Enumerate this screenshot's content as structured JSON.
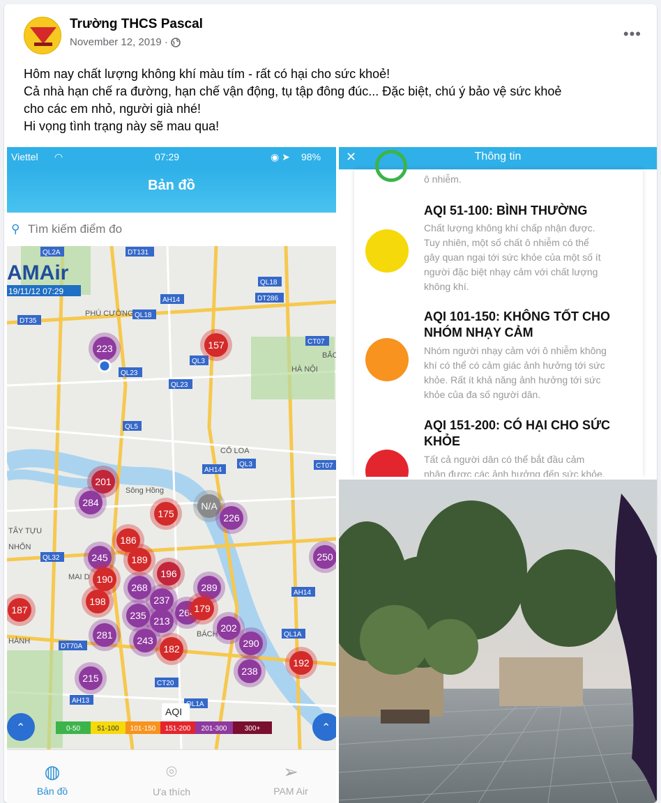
{
  "post": {
    "author": "Trường THCS Pascal",
    "date": "November 12, 2019 ·",
    "more": "•••",
    "lines": [
      "Hôm nay chất lượng không khí màu tím - rất có hại cho sức khoẻ!",
      "Cả nhà hạn chế ra đường, hạn chế vận động, tụ tập đông đúc... Đặc biệt, chú ý bảo vệ sức khoẻ",
      "cho các em nhỏ, người già nhé!",
      "Hi vọng tình trạng này sẽ mau qua!"
    ]
  },
  "phone": {
    "carrier": "Viettel",
    "time": "07:29",
    "battery": "98%",
    "nav_title": "Bản đồ",
    "search_placeholder": "Tìm kiếm điểm đo",
    "brand": "AMAir",
    "timestamp": "19/11/12 07:29",
    "place_labels": [
      "PHÚ CƯỜNG",
      "CỔ LOA",
      "TÂY TỰU",
      "NHỔN",
      "MAI D",
      "BẮC NINH",
      "HÀ NỘI",
      "Sông Hồng",
      "BÁCH KH",
      "HÀNH"
    ],
    "road_labels": [
      "QL2A",
      "DT131",
      "QL18",
      "DT286",
      "AH14",
      "QL18",
      "DT35",
      "CT07",
      "QL3",
      "QL23",
      "QL23",
      "QL5",
      "AH14",
      "QL3",
      "CT07",
      "QL32",
      "AH14",
      "QL1A",
      "DT70A",
      "CT20",
      "AH13",
      "QL1A"
    ],
    "markers": [
      {
        "v": "223",
        "c": "#8e3a9e"
      },
      {
        "v": "157",
        "c": "#d42a2a"
      },
      {
        "v": "201",
        "c": "#c2263a"
      },
      {
        "v": "284",
        "c": "#8e3a9e"
      },
      {
        "v": "175",
        "c": "#d42a2a"
      },
      {
        "v": "N/A",
        "c": "#8a8a8a"
      },
      {
        "v": "226",
        "c": "#8e3a9e"
      },
      {
        "v": "245",
        "c": "#8e3a9e"
      },
      {
        "v": "190",
        "c": "#d42a2a"
      },
      {
        "v": "198",
        "c": "#d42a2a"
      },
      {
        "v": "268",
        "c": "#8e3a9e"
      },
      {
        "v": "237",
        "c": "#8e3a9e"
      },
      {
        "v": "196",
        "c": "#c2263a"
      },
      {
        "v": "289",
        "c": "#8e3a9e"
      },
      {
        "v": "235",
        "c": "#8e3a9e"
      },
      {
        "v": "213",
        "c": "#8e3a9e"
      },
      {
        "v": "264",
        "c": "#8e3a9e"
      },
      {
        "v": "187",
        "c": "#d42a2a"
      },
      {
        "v": "281",
        "c": "#8e3a9e"
      },
      {
        "v": "243",
        "c": "#8e3a9e"
      },
      {
        "v": "182",
        "c": "#d42a2a"
      },
      {
        "v": "202",
        "c": "#8e3a9e"
      },
      {
        "v": "290",
        "c": "#8e3a9e"
      },
      {
        "v": "238",
        "c": "#8e3a9e"
      },
      {
        "v": "192",
        "c": "#d42a2a"
      },
      {
        "v": "215",
        "c": "#8e3a9e"
      },
      {
        "v": "250",
        "c": "#8e3a9e"
      },
      {
        "v": "186",
        "c": "#d42a2a"
      },
      {
        "v": "179",
        "c": "#d42a2a"
      },
      {
        "v": "189",
        "c": "#d42a2a"
      }
    ],
    "legend_title": "AQI",
    "legend": [
      {
        "label": "0-50",
        "c": "#3cb44b"
      },
      {
        "label": "51-100",
        "c": "#f5d90a"
      },
      {
        "label": "101-150",
        "c": "#f7931e"
      },
      {
        "label": "151-200",
        "c": "#e3262e"
      },
      {
        "label": "201-300",
        "c": "#8e3a9e"
      },
      {
        "label": "300+",
        "c": "#7a1030"
      }
    ],
    "tabs": [
      "Bản đồ",
      "Ưa thích",
      "PAM Air"
    ]
  },
  "info": {
    "title": "Thông tin",
    "top_fragment": "ô nhiễm.",
    "items": [
      {
        "heading": "AQI 51-100: BÌNH THƯỜNG",
        "lines": [
          "Chất lượng không khí chấp nhận được.",
          "Tuy nhiên, một số chất ô nhiễm có thể",
          "gây quan ngại tới sức khỏe của một số ít",
          "người đặc biệt nhạy cảm với chất lượng",
          "không khí."
        ],
        "color": "#f5d90a"
      },
      {
        "heading": "AQI 101-150: KHÔNG TỐT CHO NHÓM NHẠY CẢM",
        "lines": [
          "Nhóm người nhạy cảm với ô nhiễm không",
          "khí có thể có cảm giác ảnh hưởng tới sức",
          "khỏe. Rất ít khả năng ảnh hưởng tới sức",
          "khỏe của đa số người dân."
        ],
        "color": "#f7931e"
      },
      {
        "heading": "AQI 151-200: CÓ HẠI CHO SỨC KHỎE",
        "lines": [
          "Tất cả người dân có thể bắt đầu cảm",
          "nhận được các ảnh hưởng đến sức khỏe."
        ],
        "color": "#e3262e"
      }
    ]
  }
}
